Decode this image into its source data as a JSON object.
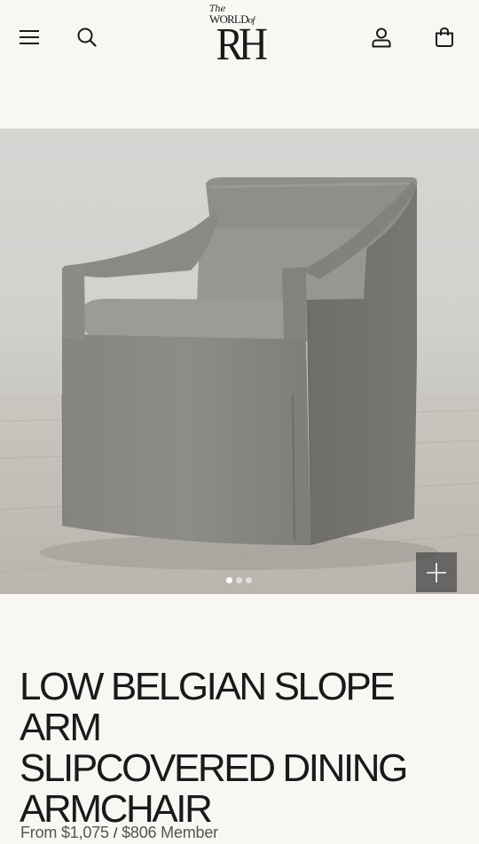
{
  "header": {
    "menu_icon": "hamburger-menu-icon",
    "search_icon": "search-icon",
    "logo": {
      "line1": "The",
      "line2a": "WORLD",
      "line2b": "of",
      "main": "RH"
    },
    "account_icon": "user-icon",
    "cart_icon": "shopping-bag-icon"
  },
  "gallery": {
    "image_alt": "Low Belgian Slope Arm Slipcovered Dining Armchair in gray linen",
    "slide_count": 3,
    "active_slide": 1,
    "zoom_icon": "plus-icon"
  },
  "product": {
    "title_lines": [
      "LOW BELGIAN SLOPE ARM",
      "SLIPCOVERED DINING",
      "ARMCHAIR"
    ],
    "price_regular": "From $1,075",
    "price_separator": "/",
    "price_member": "$806 Member"
  },
  "colors": {
    "background": "#f9f7f4",
    "text": "#1a1a1a",
    "price_text": "#555555",
    "fabric": "#8e8d89"
  }
}
